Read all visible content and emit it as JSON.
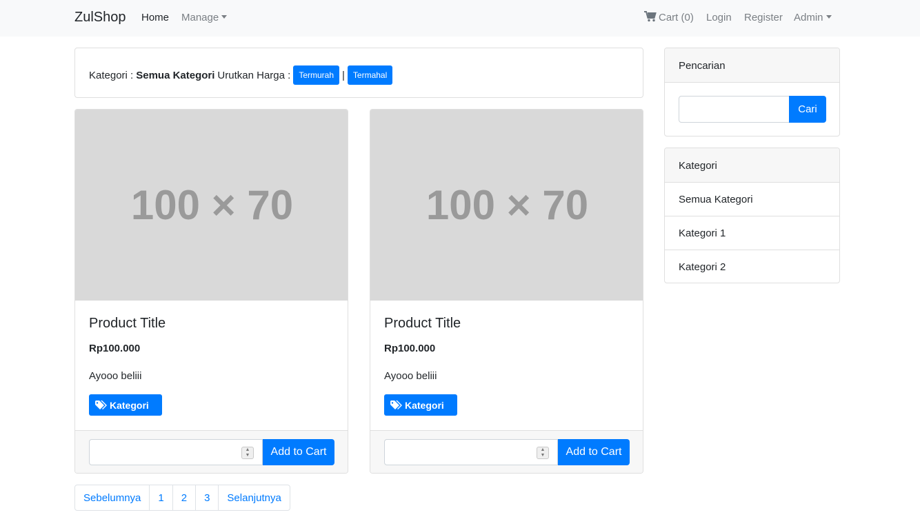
{
  "navbar": {
    "brand": "ZulShop",
    "home": "Home",
    "manage": "Manage",
    "cart": "Cart (0)",
    "login": "Login",
    "register": "Register",
    "admin": "Admin"
  },
  "filter": {
    "kategori_label": "Kategori :",
    "kategori_value": "Semua Kategori",
    "sort_label": "Urutkan Harga :",
    "cheapest": "Termurah",
    "separator": "|",
    "expensive": "Termahal"
  },
  "products": [
    {
      "thumb": "100 × 70",
      "title": "Product Title",
      "price": "Rp100.000",
      "description": "Ayooo beliii",
      "badge": "Kategori",
      "quantity": "",
      "add_button": "Add to Cart"
    },
    {
      "thumb": "100 × 70",
      "title": "Product Title",
      "price": "Rp100.000",
      "description": "Ayooo beliii",
      "badge": "Kategori",
      "quantity": "",
      "add_button": "Add to Cart"
    }
  ],
  "search": {
    "heading": "Pencarian",
    "value": "",
    "button": "Cari"
  },
  "categories": {
    "heading": "Kategori",
    "items": [
      "Semua Kategori",
      "Kategori 1",
      "Kategori 2"
    ]
  },
  "pagination": {
    "prev": "Sebelumnya",
    "pages": [
      "1",
      "2",
      "3"
    ],
    "next": "Selanjutnya"
  },
  "colors": {
    "primary": "#007bff",
    "navbar_bg": "#f8f9fa",
    "placeholder_bg": "#d9d9d9"
  }
}
